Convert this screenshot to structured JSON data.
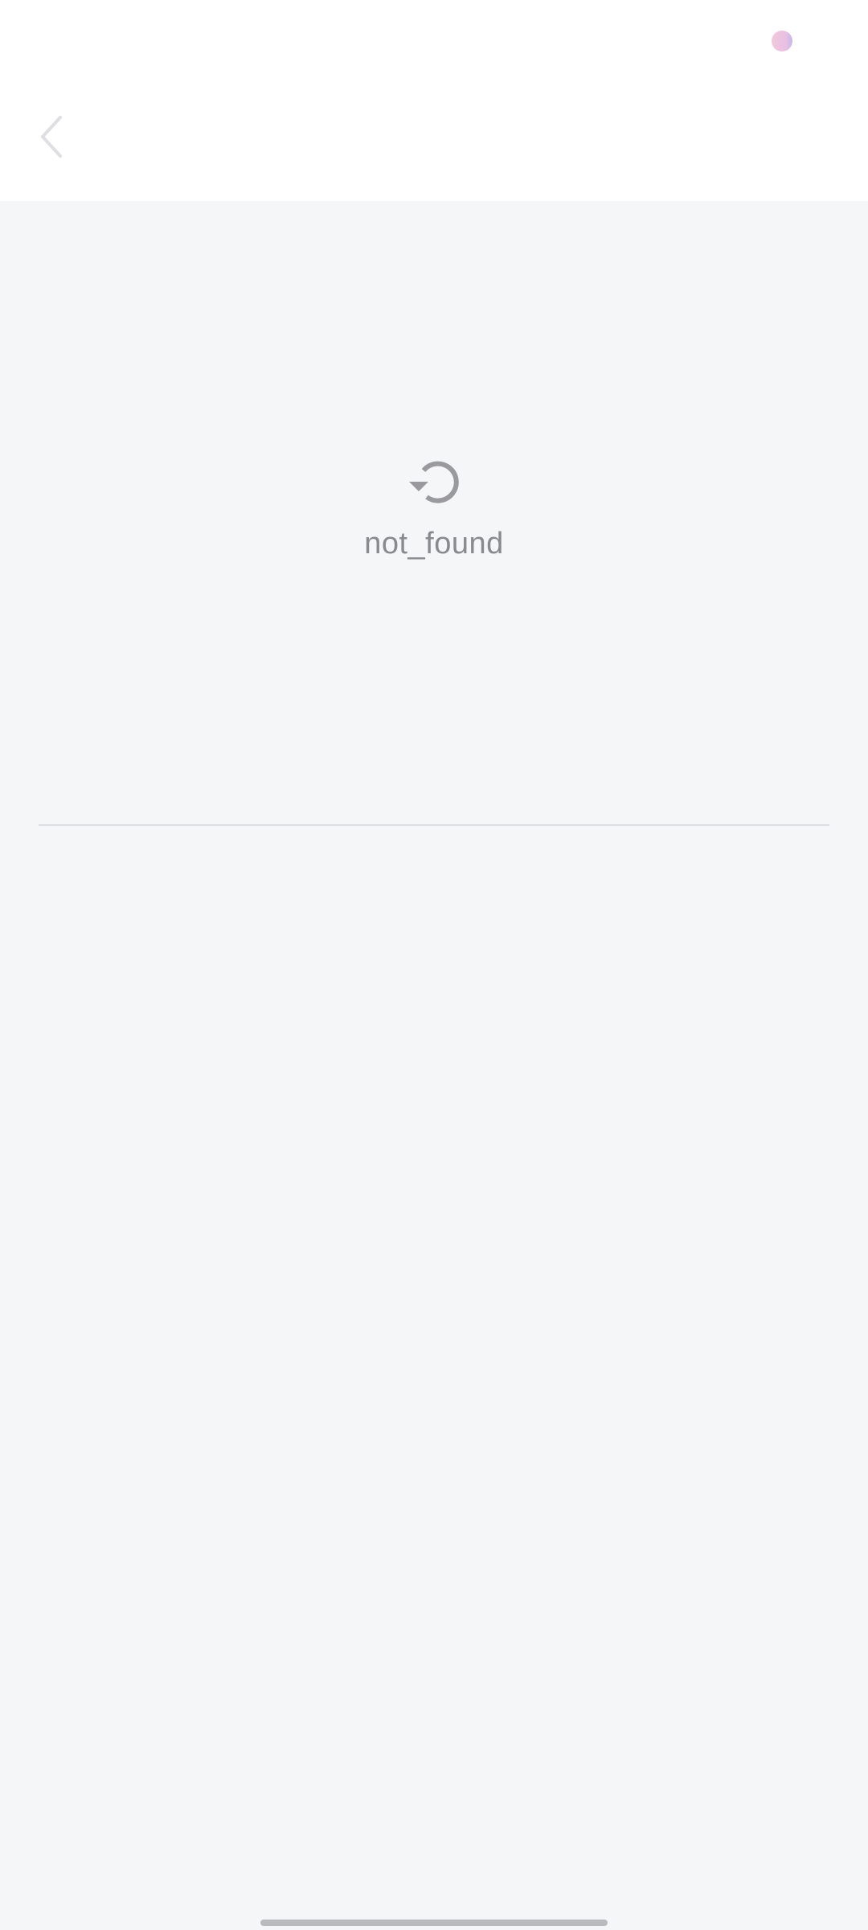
{
  "empty_state": {
    "message": "not_found",
    "icon": "refresh-icon"
  },
  "header": {
    "back_icon": "chevron-left-icon"
  },
  "colors": {
    "background": "#f5f6f8",
    "header_background": "#ffffff",
    "text_secondary": "#8a8a8e",
    "icon_gray": "#9a9a9e",
    "divider": "#dcdde1"
  }
}
